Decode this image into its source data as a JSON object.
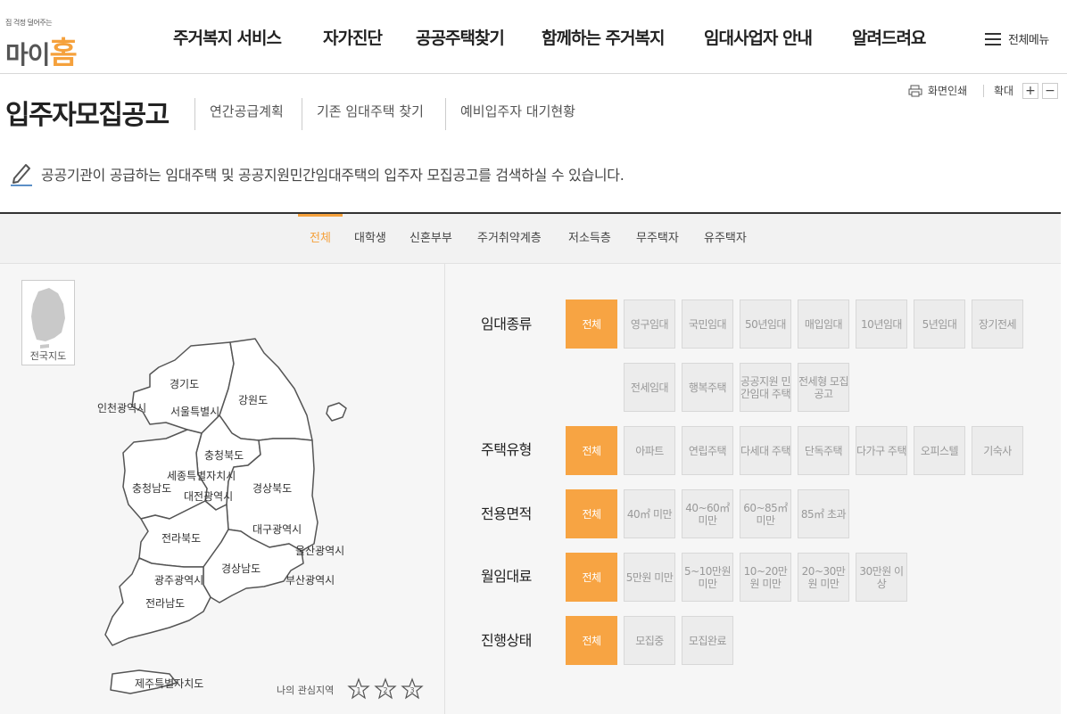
{
  "logo": {
    "tagline": "집 걱정 덜어주는",
    "name_left": "마이",
    "name_right": "홈"
  },
  "gnb": [
    "주거복지 서비스",
    "자가진단",
    "공공주택찾기",
    "함께하는 주거복지",
    "임대사업자 안내",
    "알려드려요"
  ],
  "all_menu": "전체메뉴",
  "page_title": "입주자모집공고",
  "sub_links": [
    "연간공급계획",
    "기존 임대주택 찾기",
    "예비입주자 대기현황"
  ],
  "tools": {
    "print": "화면인쇄",
    "zoom": "확대",
    "zoom_in": "+",
    "zoom_out": "−"
  },
  "description": "공공기관이 공급하는 임대주택 및 공공지원민간임대주택의 입주자 모집공고를 검색하실 수 있습니다.",
  "category_tabs": [
    "전체",
    "대학생",
    "신혼부부",
    "주거취약계층",
    "저소득층",
    "무주택자",
    "유주택자"
  ],
  "active_tab": "전체",
  "map": {
    "national_label": "전국지도",
    "regions": [
      "경기도",
      "인천광역시",
      "서울특별시",
      "강원도",
      "충청북도",
      "세종특별자치시",
      "충청남도",
      "대전광역시",
      "경상북도",
      "대구광역시",
      "전라북도",
      "울산광역시",
      "경상남도",
      "광주광역시",
      "부산광역시",
      "전라남도",
      "제주특별자치도"
    ],
    "favorite_label": "나의 관심지역",
    "favorite_slots": [
      "1",
      "2",
      "3"
    ]
  },
  "filters": {
    "rental_type": {
      "label": "임대종류",
      "options": [
        "전체",
        "영구임대",
        "국민임대",
        "50년임대",
        "매입임대",
        "10년임대",
        "5년임대",
        "장기전세",
        "전세임대",
        "행복주택",
        "공공지원 민간임대 주택",
        "전세형 모집공고"
      ]
    },
    "housing_type": {
      "label": "주택유형",
      "options": [
        "전체",
        "아파트",
        "연립주택",
        "다세대 주택",
        "단독주택",
        "다가구 주택",
        "오피스텔",
        "기숙사"
      ]
    },
    "area": {
      "label": "전용면적",
      "options": [
        "전체",
        "40㎡ 미만",
        "40~60㎡ 미만",
        "60~85㎡ 미만",
        "85㎡ 초과"
      ]
    },
    "rent": {
      "label": "월임대료",
      "options": [
        "전체",
        "5만원 미만",
        "5~10만원 미만",
        "10~20만원 미만",
        "20~30만원 미만",
        "30만원 이상"
      ]
    },
    "status": {
      "label": "진행상태",
      "options": [
        "전체",
        "모집중",
        "모집완료"
      ]
    }
  },
  "colors": {
    "accent": "#f7a443",
    "option_bg": "#ececec",
    "panel_bg": "#f6f6f6"
  }
}
